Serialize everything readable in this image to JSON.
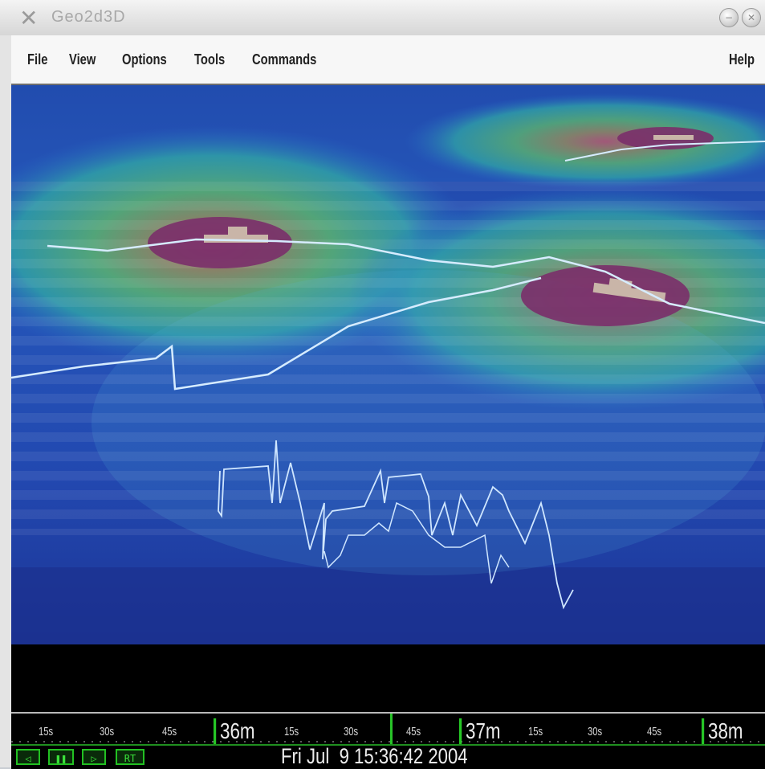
{
  "window": {
    "title": "Geo2d3D"
  },
  "menu": {
    "items": [
      "File",
      "View",
      "Options",
      "Tools",
      "Commands"
    ],
    "help": "Help"
  },
  "timeline": {
    "ticks": [
      {
        "label": "15s",
        "major": false
      },
      {
        "label": "30s",
        "major": false
      },
      {
        "label": "45s",
        "major": false
      },
      {
        "label": "36m",
        "major": true
      },
      {
        "label": "15s",
        "major": false
      },
      {
        "label": "30s",
        "major": false
      },
      {
        "label": "45s",
        "major": false
      },
      {
        "label": "37m",
        "major": true
      },
      {
        "label": "15s",
        "major": false
      },
      {
        "label": "30s",
        "major": false
      },
      {
        "label": "45s",
        "major": false
      },
      {
        "label": "38m",
        "major": true
      }
    ]
  },
  "playback": {
    "controls": [
      {
        "name": "rewind-button",
        "glyph": "◁"
      },
      {
        "name": "pause-button",
        "glyph": "❚❚"
      },
      {
        "name": "play-button",
        "glyph": "▷"
      },
      {
        "name": "realtime-button",
        "glyph": "RT"
      }
    ],
    "datetime": "Fri Jul  9 15:36:42 2004"
  },
  "colors": {
    "ocean_deep": "#1b3fa8",
    "ocean_mid": "#2a68c8",
    "sonar_green": "#5fb07a",
    "ship_zone": "#7a2f6a",
    "track": "#cfe6ff",
    "timeline_green": "#26c726"
  }
}
